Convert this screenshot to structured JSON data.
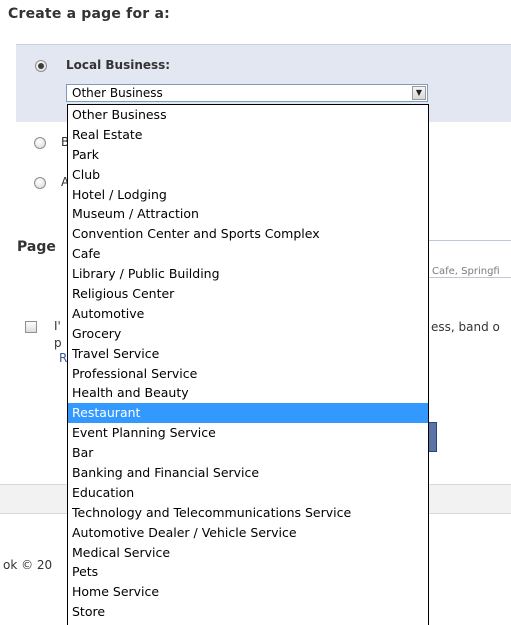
{
  "page": {
    "heading": "Create a page for a:"
  },
  "local_business": {
    "label": "Local Business:",
    "selected_value": "Other Business"
  },
  "background_fragments": {
    "radio2_letter": "B",
    "radio3_letter": "A",
    "page_name_heading": "Page",
    "example_text": "Cafe, Springfi",
    "terms_line1_start": "I'",
    "terms_line1_end": "ess, band o",
    "terms_line2": "p",
    "terms_line3": "R",
    "footer_text": "ok © 20"
  },
  "dropdown": {
    "options": [
      "Other Business",
      "Real Estate",
      "Park",
      "Club",
      "Hotel / Lodging",
      "Museum / Attraction",
      "Convention Center and Sports Complex",
      "Cafe",
      "Library / Public Building",
      "Religious Center",
      "Automotive",
      "Grocery",
      "Travel Service",
      "Professional Service",
      "Health and Beauty",
      "Restaurant",
      "Event Planning Service",
      "Bar",
      "Banking and Financial Service",
      "Education",
      "Technology and Telecommunications Service",
      "Automotive Dealer / Vehicle Service",
      "Medical Service",
      "Pets",
      "Home Service",
      "Store"
    ],
    "highlighted": "Restaurant"
  },
  "colors": {
    "panel_bg": "#e3e7f1",
    "highlight": "#3399ff",
    "link": "#3b5998"
  }
}
